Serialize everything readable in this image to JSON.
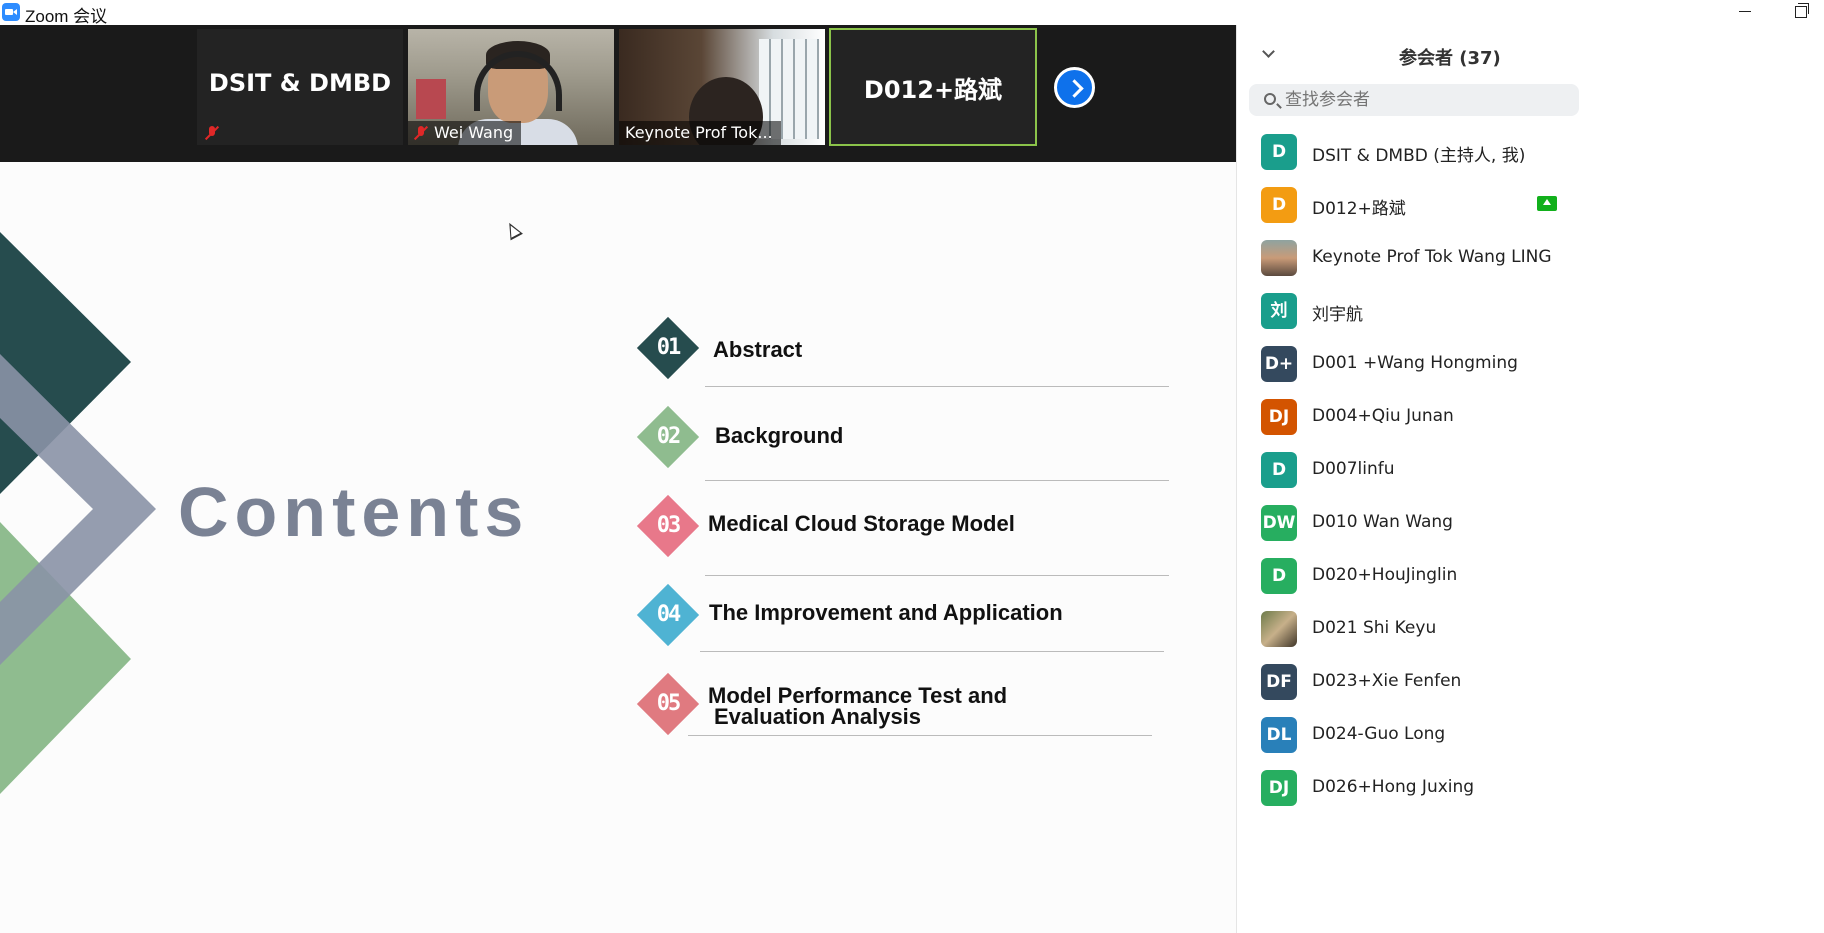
{
  "window": {
    "title": "Zoom 会议"
  },
  "video_strip": {
    "tiles": [
      {
        "name": "DSIT & DMBD",
        "muted": true,
        "kind": "name-only"
      },
      {
        "name": "Wei Wang",
        "muted": true,
        "kind": "video"
      },
      {
        "name": "Keynote Prof Tok...",
        "muted": false,
        "kind": "video"
      },
      {
        "name": "D012+路斌",
        "muted": false,
        "kind": "name-only",
        "active_speaker": true
      }
    ],
    "next_icon": "chevron-right-icon"
  },
  "slide": {
    "title": "Contents",
    "items": [
      {
        "num": "01",
        "label": "Abstract",
        "color": "#264c4e"
      },
      {
        "num": "02",
        "label": "Background",
        "color": "#8fbc8f"
      },
      {
        "num": "03",
        "label": "Medical Cloud Storage Model",
        "color": "#e8788a"
      },
      {
        "num": "04",
        "label": "The Improvement and Application",
        "color": "#4fb3d3"
      },
      {
        "num": "05",
        "label": "Model Performance Test and",
        "label2": "Evaluation Analysis",
        "color": "#e07a80"
      }
    ]
  },
  "participants": {
    "title": "参会者 (37)",
    "search_placeholder": "查找参会者",
    "list": [
      {
        "initials": "D",
        "name": "DSIT & DMBD (主持人, 我)",
        "color": "#1a9e8c"
      },
      {
        "initials": "D",
        "name": "D012+路斌",
        "color": "#f39c12",
        "sharing": true
      },
      {
        "initials": "",
        "name": "Keynote Prof Tok Wang LING",
        "photo": "photo1"
      },
      {
        "initials": "刘",
        "name": "刘宇航",
        "color": "#1a9e8c"
      },
      {
        "initials": "D+",
        "name": "D001 +Wang Hongming",
        "color": "#34495e"
      },
      {
        "initials": "DJ",
        "name": "D004+Qiu Junan",
        "color": "#d35400"
      },
      {
        "initials": "D",
        "name": "D007linfu",
        "color": "#1a9e8c"
      },
      {
        "initials": "DW",
        "name": "D010 Wan Wang",
        "color": "#27ae60"
      },
      {
        "initials": "D",
        "name": "D020+HouJinglin",
        "color": "#27ae60"
      },
      {
        "initials": "",
        "name": "D021 Shi Keyu",
        "photo": "photo2"
      },
      {
        "initials": "DF",
        "name": "D023+Xie Fenfen",
        "color": "#34495e"
      },
      {
        "initials": "DL",
        "name": "D024-Guo Long",
        "color": "#2980b9"
      },
      {
        "initials": "DJ",
        "name": "D026+Hong Juxing",
        "color": "#27ae60"
      }
    ]
  }
}
